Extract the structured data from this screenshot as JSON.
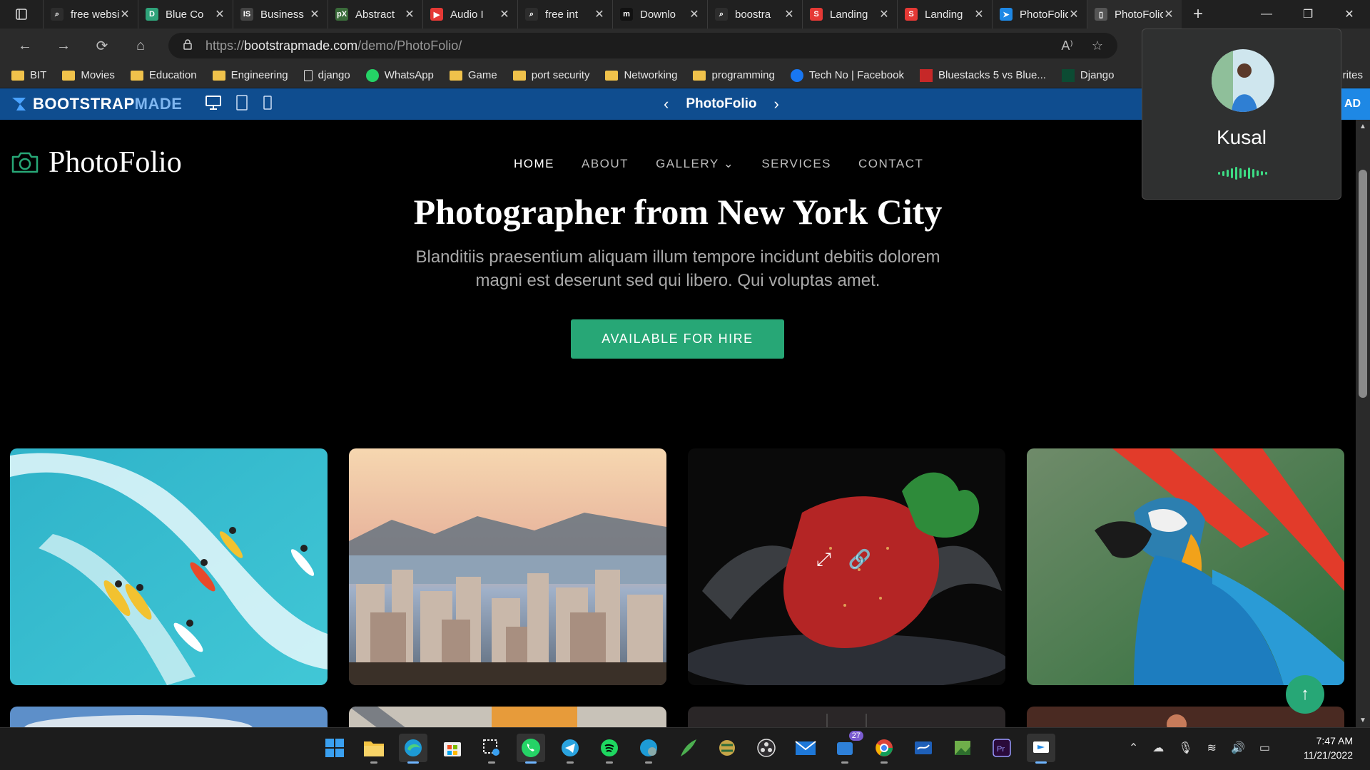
{
  "browser": {
    "tabs": [
      {
        "title": "free website templates",
        "fav_color": "#2d2d2d",
        "fav_glyph": "⌕"
      },
      {
        "title": "Blue Co",
        "fav_color": "#2fa37a",
        "fav_glyph": "D"
      },
      {
        "title": "Business",
        "fav_color": "#444444",
        "fav_glyph": "IS"
      },
      {
        "title": "Abstract",
        "fav_color": "#3a6b3a",
        "fav_glyph": "pX"
      },
      {
        "title": "Audio I",
        "fav_color": "#e53935",
        "fav_glyph": "▶"
      },
      {
        "title": "free int",
        "fav_color": "#2d2d2d",
        "fav_glyph": "⌕"
      },
      {
        "title": "Downlo",
        "fav_color": "#111111",
        "fav_glyph": "m"
      },
      {
        "title": "boostra",
        "fav_color": "#2d2d2d",
        "fav_glyph": "⌕"
      },
      {
        "title": "Landing",
        "fav_color": "#e53935",
        "fav_glyph": "S"
      },
      {
        "title": "Landing",
        "fav_color": "#e53935",
        "fav_glyph": "S"
      },
      {
        "title": "PhotoFolio",
        "fav_color": "#1e88e5",
        "fav_glyph": "➤"
      },
      {
        "title": "PhotoFolio",
        "fav_color": "#555555",
        "fav_glyph": "▯"
      }
    ],
    "url_prefix": "https://",
    "url_host": "bootstrapmade.com",
    "url_path": "/demo/PhotoFolio/",
    "bookmarks": [
      {
        "label": "BIT",
        "type": "folder"
      },
      {
        "label": "Movies",
        "type": "folder"
      },
      {
        "label": "Education",
        "type": "folder"
      },
      {
        "label": "Engineering",
        "type": "folder"
      },
      {
        "label": "django",
        "type": "page"
      },
      {
        "label": "WhatsApp",
        "type": "whatsapp"
      },
      {
        "label": "Game",
        "type": "folder"
      },
      {
        "label": "port security",
        "type": "folder"
      },
      {
        "label": "Networking",
        "type": "folder"
      },
      {
        "label": "programming",
        "type": "folder"
      },
      {
        "label": "Tech No | Facebook",
        "type": "facebook"
      },
      {
        "label": "Bluestacks 5 vs Blue...",
        "type": "mt"
      },
      {
        "label": "Django",
        "type": "dj"
      }
    ],
    "bookmarks_more": "rites"
  },
  "bootstrapmade_bar": {
    "logo_bootstrap": "BOOTSTRAP",
    "logo_made": "MADE",
    "demo_name": "PhotoFolio",
    "download_label": "AD"
  },
  "site": {
    "brand": "PhotoFolio",
    "menu": [
      "HOME",
      "ABOUT",
      "GALLERY",
      "SERVICES",
      "CONTACT"
    ],
    "hero_title": "Photographer from New York City",
    "hero_text": "Blanditiis praesentium aliquam illum tempore incidunt debitis dolorem magni est deserunt sed qui libero. Qui voluptas amet.",
    "cta": "AVAILABLE FOR HIRE",
    "gallery": [
      "surfers-photo",
      "city-skyline-photo",
      "strawberry-splash-photo",
      "macaw-parrot-photo"
    ]
  },
  "call_popup": {
    "name": "Kusal"
  },
  "taskbar": {
    "time": "7:47 AM",
    "date": "11/21/2022",
    "mail_badge": "27"
  },
  "colors": {
    "accent": "#27a776",
    "bm_blue": "#0f4d8f"
  }
}
